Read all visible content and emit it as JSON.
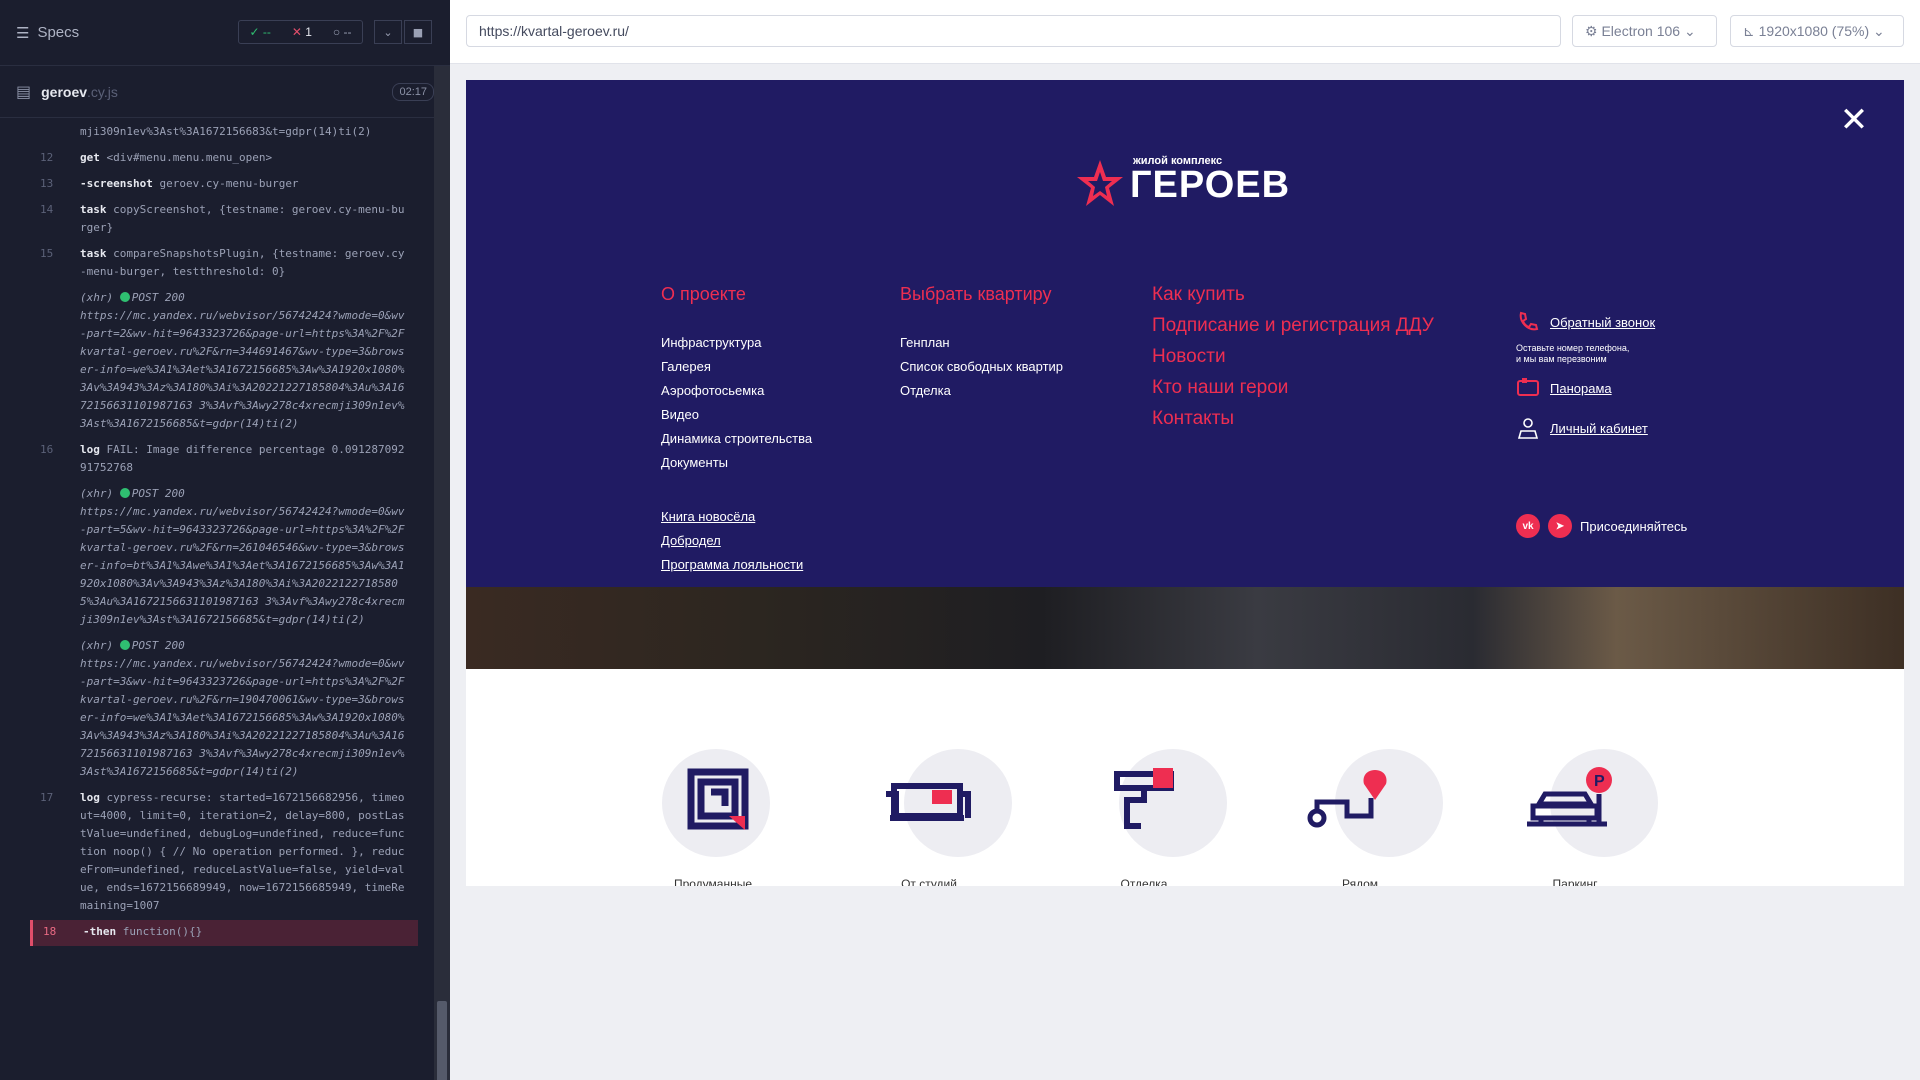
{
  "runner": {
    "specs_label": "Specs",
    "passed": "--",
    "failed": "1",
    "pending": "--",
    "spec_file": "geroev",
    "spec_ext": ".cy.js",
    "duration": "02:17"
  },
  "commands": [
    {
      "num": "",
      "name": "",
      "text": "mji309n1ev%3Ast%3A1672156683&t=gdpr(14)ti(2)"
    },
    {
      "num": "12",
      "name": "get",
      "text": "<div#menu.menu.menu_open>"
    },
    {
      "num": "13",
      "name": "-screenshot",
      "text": "geroev.cy-menu-burger"
    },
    {
      "num": "14",
      "name": "task",
      "text": "copyScreenshot, {testname: geroev.cy-menu-burger}"
    },
    {
      "num": "15",
      "name": "task",
      "text": "compareSnapshotsPlugin, {testname: geroev.cy-menu-burger, testthreshold: 0}"
    },
    {
      "num": "",
      "name": "(xhr)",
      "status": "POST 200",
      "text": "https://mc.yandex.ru/webvisor/56742424?wmode=0&wv-part=2&wv-hit=9643323726&page-url=https%3A%2F%2Fkvartal-geroev.ru%2F&rn=344691467&wv-type=3&browser-info=we%3A1%3Aet%3A1672156685%3Aw%3A1920x1080%3Av%3A943%3Az%3A180%3Ai%3A20221227185804%3Au%3A1672156631101987163 3%3Avf%3Awy278c4xrecmji309n1ev%3Ast%3A1672156685&t=gdpr(14)ti(2)"
    },
    {
      "num": "16",
      "name": "log",
      "text": "FAIL: Image difference percentage 0.09128709291752768"
    },
    {
      "num": "",
      "name": "(xhr)",
      "status": "POST 200",
      "text": "https://mc.yandex.ru/webvisor/56742424?wmode=0&wv-part=5&wv-hit=9643323726&page-url=https%3A%2F%2Fkvartal-geroev.ru%2F&rn=261046546&wv-type=3&browser-info=bt%3A1%3Awe%3A1%3Aet%3A1672156685%3Aw%3A1920x1080%3Av%3A943%3Az%3A180%3Ai%3A20221227185805%3Au%3A1672156631101987163 3%3Avf%3Awy278c4xrecmji309n1ev%3Ast%3A1672156685&t=gdpr(14)ti(2)"
    },
    {
      "num": "",
      "name": "(xhr)",
      "status": "POST 200",
      "text": "https://mc.yandex.ru/webvisor/56742424?wmode=0&wv-part=3&wv-hit=9643323726&page-url=https%3A%2F%2Fkvartal-geroev.ru%2F&rn=190470061&wv-type=3&browser-info=we%3A1%3Aet%3A1672156685%3Aw%3A1920x1080%3Av%3A943%3Az%3A180%3Ai%3A20221227185804%3Au%3A1672156631101987163 3%3Avf%3Awy278c4xrecmji309n1ev%3Ast%3A1672156685&t=gdpr(14)ti(2)"
    },
    {
      "num": "17",
      "name": "log",
      "text": "cypress-recurse: started=1672156682956, timeout=4000, limit=0, iteration=2, delay=800, postLastValue=undefined, debugLog=undefined, reduce=function noop() { // No operation performed. }, reduceFrom=undefined, reduceLastValue=false, yield=value, ends=1672156689949, now=1672156685949, timeRemaining=1007"
    },
    {
      "num": "18",
      "name": "-then",
      "text": "function(){}"
    }
  ],
  "browser": {
    "url": "https://kvartal-geroev.ru/",
    "engine": "Electron 106",
    "viewport": "1920x1080 (75%)"
  },
  "site": {
    "logo_small": "жилой комплекс",
    "logo_big": "ГЕРОЕВ",
    "col1": {
      "heading": "О проекте",
      "links": [
        "Инфраструктура",
        "Галерея",
        "Аэрофотосьемка",
        "Видео",
        "Динамика строительства",
        "Документы"
      ],
      "extra": [
        "Книга новосёла",
        "Добродел",
        "Программа лояльности"
      ]
    },
    "col2": {
      "heading": "Выбрать квартиру",
      "links": [
        "Генплан",
        "Список свободных квартир",
        "Отделка"
      ]
    },
    "col3": [
      "Как купить",
      "Подписание и регистрация ДДУ",
      "Новости",
      "Кто наши герои",
      "Контакты"
    ],
    "contacts": {
      "callback": "Обратный звонок",
      "note_line1": "Оставьте номер телефона,",
      "note_line2": "и мы вам перезвоним",
      "panorama": "Панорама",
      "cabinet": "Личный кабинет",
      "join": "Присоединяйтесь",
      "vk": "vk"
    },
    "features": [
      "Продуманные",
      "От студий",
      "Отделка",
      "Рядом",
      "Паркинг"
    ],
    "accent": "#ee2e51",
    "navy": "#201b63"
  }
}
